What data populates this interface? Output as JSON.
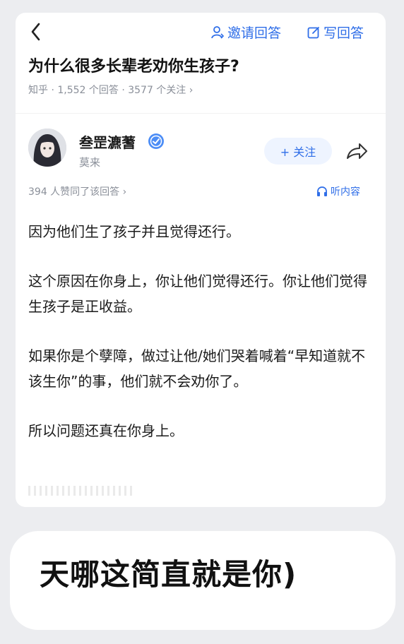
{
  "header": {
    "invite_label": "邀请回答",
    "write_label": "写回答"
  },
  "question": {
    "title": "为什么很多长辈老劝你生孩子?",
    "meta": "知乎 · 1,552 个回答 · 3577 个关注 ›"
  },
  "author": {
    "name": "叁罡瀌蓍",
    "subtitle": "莫来",
    "follow_label": "+ 关注"
  },
  "answer": {
    "likes": "394 人赞同了该回答 ›",
    "listen_label": "听内容",
    "paragraphs": [
      "因为他们生了孩子并且觉得还行。",
      "这个原因在你身上，你让他们觉得还行。你让他们觉得生孩子是正收益。",
      "如果你是个孽障，做过让他/她们哭着喊着“早知道就不该生你”的事，他们就不会劝你了。",
      "所以问题还真在你身上。"
    ]
  },
  "caption": {
    "text": "天哪这简直就是你)"
  },
  "colors": {
    "accent": "#2f6ee8",
    "background": "#ecedf0",
    "card": "#ffffff"
  },
  "icons": {
    "back": "chevron-left-icon",
    "invite": "person-icon",
    "write": "edit-icon",
    "badge": "verified-badge-icon",
    "share": "share-icon",
    "listen": "headphones-icon"
  }
}
